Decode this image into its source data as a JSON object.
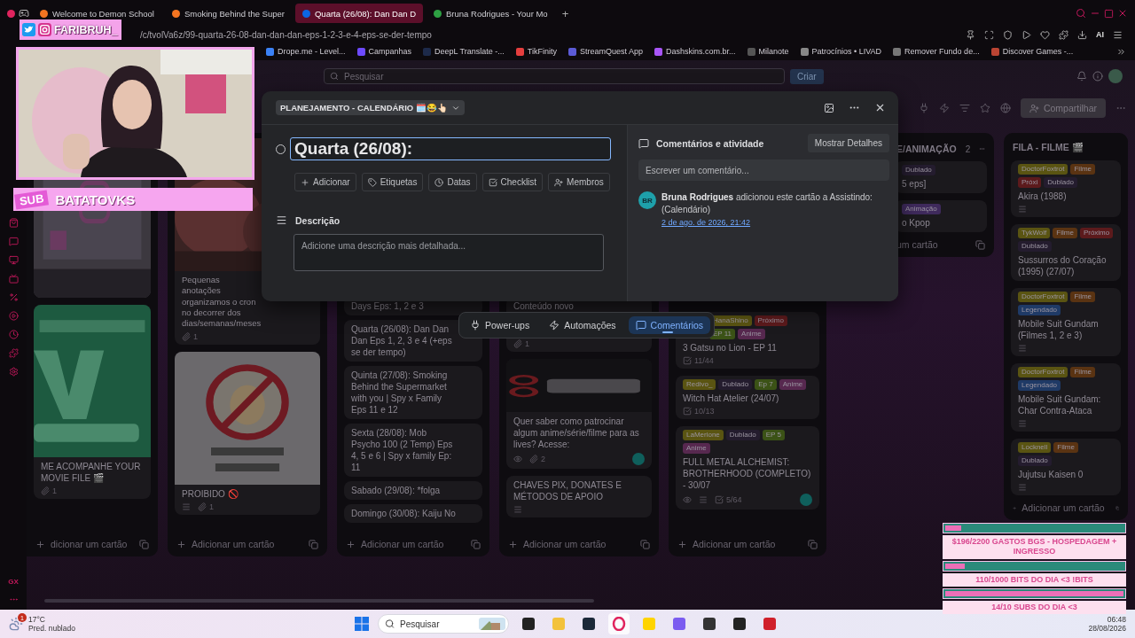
{
  "browser": {
    "tabs": [
      {
        "title": "Welcome to Demon School",
        "selected": false
      },
      {
        "title": "Smoking Behind the Super",
        "selected": false
      },
      {
        "title": "Quarta (26/08): Dan Dan D",
        "selected": true
      },
      {
        "title": "Bruna Rodrigues - Your Mo",
        "selected": false
      }
    ],
    "new_tab": "+",
    "url": "/c/tvolVa6z/99-quarta-26-08-dan-dan-dan-eps-1-2-3-e-4-eps-se-der-tempo",
    "ai": "AI",
    "bookmarks": [
      "Drope.me - Level...",
      "Campanhas",
      "DeepL Translate -...",
      "TikFinity",
      "StreamQuest App",
      "Dashskins.com.br...",
      "Milanote",
      "Patrocínios • LIVAD",
      "Remover Fundo de...",
      "Discover Games -..."
    ]
  },
  "sidebar": {
    "bottom_label": "GX"
  },
  "trello": {
    "search": {
      "placeholder": "Pesquisar"
    },
    "create": "Criar",
    "share": "Compartilhar"
  },
  "board": {
    "columns": [
      {
        "kind": "list",
        "cards": [
          {
            "cover": true
          },
          {
            "cover": true,
            "title": "ME ACOMPANHE YOUR MOVIE FILE 🎬",
            "badges": [
              {
                "kind": "attachment",
                "text": "1"
              }
            ]
          }
        ],
        "add": "dicionar um cartão"
      },
      {
        "kind": "list",
        "cards": [
          {
            "cover": true,
            "title": "Pequenas anotações organizamos o cron no decorrer dos dias/semanas/meses",
            "badges": [
              {
                "kind": "attachment",
                "text": "1"
              }
            ]
          },
          {
            "cover": true,
            "title": "PROIBIDO 🚫",
            "badges": [
              {
                "kind": "description"
              },
              {
                "kind": "attachment",
                "text": "1"
              }
            ]
          }
        ],
        "add": "Adicionar um cartão"
      },
      {
        "kind": "list",
        "cards": [
          {
            "title": "Days Eps: 1, 2 e 3"
          },
          {
            "title": "Quarta (26/08): Dan Dan Dan Eps 1, 2, 3 e 4 (+eps se der tempo)"
          },
          {
            "title": "Quinta (27/08): Smoking Behind the Supermarket with you | Spy x Family Eps 11 e 12"
          },
          {
            "title": "Sexta (28/08): Mob Psycho 100 (2 Temp) Eps 4, 5 e 6 | Spy x family Ep: 11"
          },
          {
            "title": "Sabado (29/08): *folga"
          },
          {
            "title": "Domingo (30/08): Kaiju No"
          }
        ],
        "add": "Adicionar um cartão"
      },
      {
        "kind": "list",
        "cards": [
          {
            "title": "Conteúdo novo",
            "badges": [
              {
                "kind": "attachment",
                "text": "1"
              }
            ]
          },
          {
            "cover": true,
            "title": "Quer saber como patrocinar algum anime/série/filme para as lives? Acesse:",
            "badges": [
              {
                "kind": "watch"
              },
              {
                "kind": "attachment",
                "text": "2"
              },
              {
                "kind": "avatar"
              }
            ]
          },
          {
            "title": "CHAVES PIX, DONATES E MÉTODOS DE APOIO",
            "badges": [
              {
                "kind": "description"
              }
            ]
          }
        ],
        "add": "Adicionar um cartão"
      },
      {
        "kind": "list",
        "cards": [
          {
            "labels": [
              {
                "text": "HanaShino",
                "color": "#5a5412"
              },
              {
                "text": "Próximo",
                "color": "#5c1a1c"
              },
              {
                "text": "EP 11",
                "color": "#3b5216"
              },
              {
                "text": "Anime",
                "color": "#57284f"
              }
            ],
            "title": "3 Gatsu no Lion - EP 11",
            "badges": [
              {
                "kind": "checklist",
                "text": "11/44"
              }
            ]
          },
          {
            "labels": [
              {
                "text": "Redivo_",
                "color": "#5a5412"
              },
              {
                "text": "Dublado",
                "color": "#241c2e"
              },
              {
                "text": "Ep 7",
                "color": "#3b5216"
              },
              {
                "text": "Anime",
                "color": "#57284f"
              }
            ],
            "title": "Witch Hat Atelier (24/07)",
            "badges": [
              {
                "kind": "checklist",
                "text": "10/13"
              }
            ]
          },
          {
            "labels": [
              {
                "text": "LaMerione",
                "color": "#5a5412"
              },
              {
                "text": "Dublado",
                "color": "#241c2e"
              },
              {
                "text": "EP 5",
                "color": "#3b5216"
              },
              {
                "text": "Anime",
                "color": "#57284f"
              }
            ],
            "title": "FULL METAL ALCHEMIST: BROTHERHOOD (COMPLETO) - 30/07",
            "badges": [
              {
                "kind": "watch"
              },
              {
                "kind": "description"
              },
              {
                "kind": "checklist",
                "text": "5/64"
              },
              {
                "kind": "avatar"
              }
            ]
          }
        ],
        "add": "Adicionar um cartão"
      },
      {
        "kind": "covered",
        "header": "E/ANIMAÇÃO",
        "count": "2",
        "cards": [
          {
            "labels": [
              {
                "text": "Dublado",
                "color": "#241c2e"
              }
            ],
            "title": "5 eps]"
          },
          {
            "labels": [
              {
                "text": "Animação",
                "color": "#3f2a5c"
              }
            ],
            "title": "o Kpop"
          }
        ],
        "add": "um cartão"
      },
      {
        "kind": "list",
        "header": "FILA - FILME 🎬",
        "cards": [
          {
            "labels": [
              {
                "text": "DoctorFoxtrot",
                "color": "#5a5412"
              },
              {
                "text": "Filme",
                "color": "#5a3312"
              },
              {
                "text": "Próxi",
                "color": "#5c1a1c"
              },
              {
                "text": "Dublado",
                "color": "#241c2e"
              }
            ],
            "title": "Akira (1988)",
            "badges": [
              {
                "kind": "description"
              }
            ]
          },
          {
            "labels": [
              {
                "text": "TykWolf",
                "color": "#5a5412"
              },
              {
                "text": "Filme",
                "color": "#5a3312"
              },
              {
                "text": "Próximo",
                "color": "#5c1a1c"
              },
              {
                "text": "Dublado",
                "color": "#241c2e"
              }
            ],
            "title": "Sussurros do Coração (1995) (27/07)"
          },
          {
            "labels": [
              {
                "text": "DoctorFoxtrot",
                "color": "#5a5412"
              },
              {
                "text": "Filme",
                "color": "#5a3312"
              },
              {
                "text": "Legendado",
                "color": "#1f3a66"
              }
            ],
            "title": "Mobile Suit Gundam (Filmes 1, 2 e 3)",
            "badges": [
              {
                "kind": "description"
              }
            ]
          },
          {
            "labels": [
              {
                "text": "DoctorFoxtrot",
                "color": "#5a5412"
              },
              {
                "text": "Filme",
                "color": "#5a3312"
              },
              {
                "text": "Legendado",
                "color": "#1f3a66"
              }
            ],
            "title": "Mobile Suit Gundam: Char Contra-Ataca",
            "badges": [
              {
                "kind": "description"
              }
            ]
          },
          {
            "labels": [
              {
                "text": "Locknell",
                "color": "#5a5412"
              },
              {
                "text": "Filme",
                "color": "#5a3312"
              },
              {
                "text": "Dublado",
                "color": "#241c2e"
              }
            ],
            "title": "Jujutsu Kaisen 0",
            "badges": [
              {
                "kind": "description"
              }
            ]
          }
        ],
        "add": "Adicionar um cartão"
      }
    ]
  },
  "card_modal": {
    "list": "PLANEJAMENTO - CALENDÁRIO 🗓️😂👆🏻",
    "completed": false,
    "title": "Quarta (26/08):",
    "actions": [
      "Adicionar",
      "Etiquetas",
      "Datas",
      "Checklist",
      "Membros"
    ],
    "description_heading": "Descrição",
    "description_placeholder": "Adicione uma descrição mais detalhada...",
    "activity_heading": "Comentários e atividade",
    "details_button": "Mostrar Detalhes",
    "comment_placeholder": "Escrever um comentário...",
    "activity": [
      {
        "initials": "BR",
        "text": "**Bruna Rodrigues** adicionou este cartão a Assistindo: (Calendário)",
        "time": "2 de ago. de 2026, 21:42"
      }
    ]
  },
  "bottom_bar": [
    {
      "label": "Power-ups",
      "selected": false
    },
    {
      "label": "Automações",
      "selected": false
    },
    {
      "label": "Comentários",
      "selected": true
    }
  ],
  "taskbar": {
    "weather_badge": "1",
    "temperature": "17°C",
    "forecast": "Pred. nublado",
    "search": {
      "placeholder": "Pesquisar"
    },
    "apps": [
      {
        "selected": false
      },
      {
        "selected": false
      },
      {
        "selected": false
      },
      {
        "selected": true
      },
      {
        "selected": false
      },
      {
        "selected": false
      },
      {
        "selected": false
      },
      {
        "selected": false
      },
      {
        "selected": false
      }
    ],
    "time": "06:48",
    "date": "28/08/2026"
  },
  "overlay": {
    "handle": "FARIBRUH_",
    "sub_tag": "SUB",
    "subscriber": "BATATOVKS",
    "goals": [
      {
        "text": "$196/2200 GASTOS BGS - HOSPEDAGEM + INGRESSO",
        "level": 0.09
      },
      {
        "text": "110/1000 BITS DO DIA <3 !BITS",
        "level": 0.11
      },
      {
        "text": "14/10 SUBS DO DIA <3",
        "level": 1
      }
    ]
  }
}
